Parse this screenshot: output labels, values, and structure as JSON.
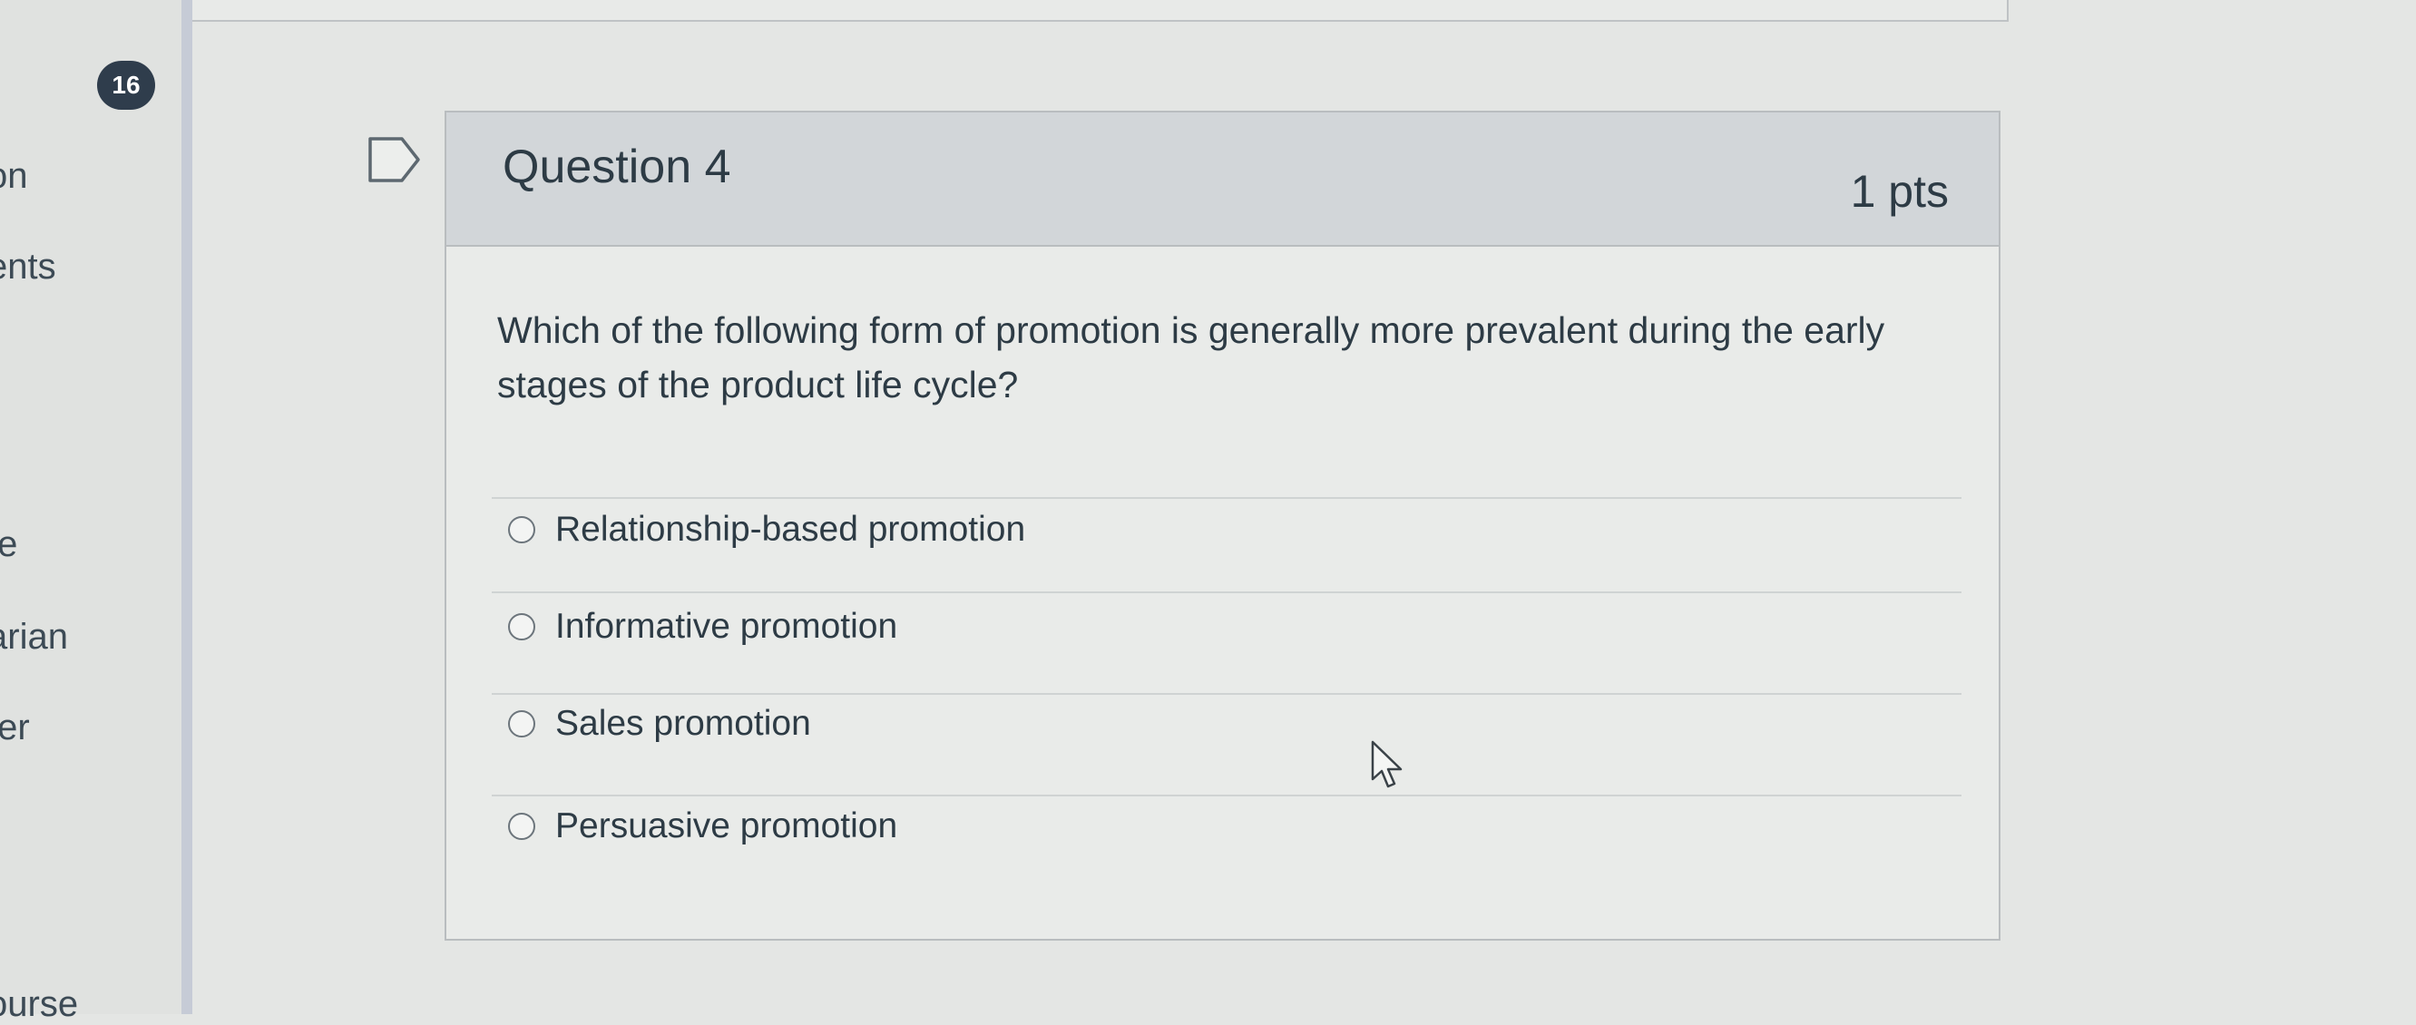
{
  "sidebar": {
    "badge_count": "16",
    "items": [
      {
        "label": "on"
      },
      {
        "label": "ents"
      },
      {
        "label": "te"
      },
      {
        "label": "arian"
      },
      {
        "label": "ter"
      },
      {
        "label": "ourse"
      }
    ]
  },
  "question": {
    "title": "Question 4",
    "points": "1 pts",
    "text": "Which of the following form of promotion is generally more prevalent during the early stages of the product life cycle?",
    "answers": [
      {
        "label": "Relationship-based promotion",
        "selected": false
      },
      {
        "label": "Informative promotion",
        "selected": false
      },
      {
        "label": "Sales promotion",
        "selected": false
      },
      {
        "label": "Persuasive promotion",
        "selected": false
      }
    ]
  },
  "icons": {
    "flag": "flag-icon",
    "cursor": "mouse-pointer-icon"
  },
  "colors": {
    "text": "#2d3b45",
    "header_background": "#d2d6d9",
    "badge_background": "#2f3d4c"
  }
}
